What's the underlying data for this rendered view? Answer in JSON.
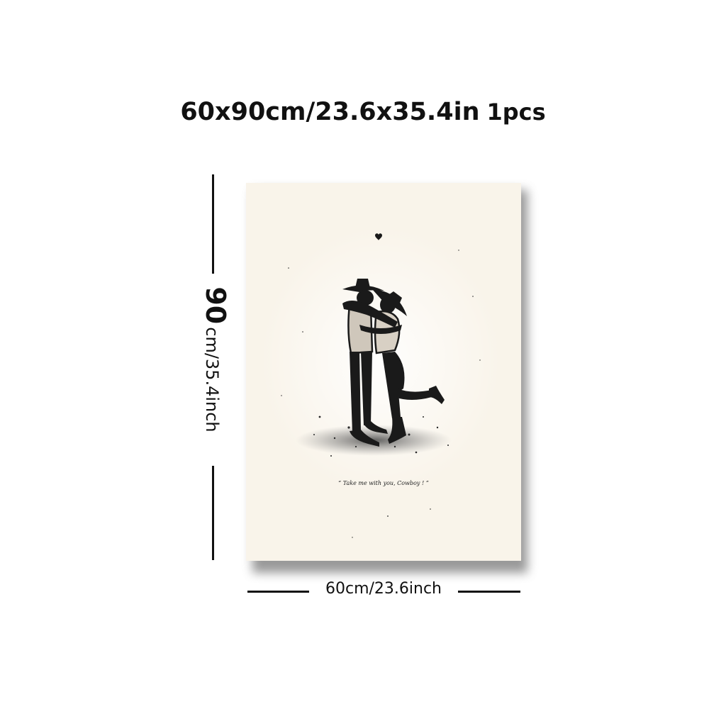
{
  "header": {
    "size_text": "60x90cm/23.6x35.4in",
    "quantity_text": "1pcs"
  },
  "dimensions": {
    "height_value": "90",
    "height_text": "cm/35.4inch",
    "width_text": "60cm/23.6inch"
  },
  "poster": {
    "caption": "“ Take me with you, Cowboy ! ”",
    "background_color": "#f9f4ea",
    "ink_color": "#1a1a1a"
  }
}
